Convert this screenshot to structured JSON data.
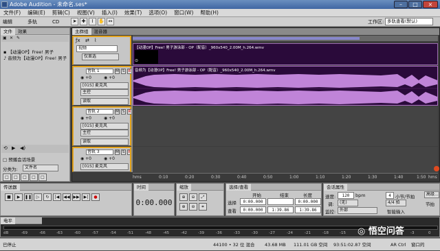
{
  "window": {
    "title": "Adobe Audition - 未命名.ses*",
    "min": "–",
    "max": "□",
    "close": "×"
  },
  "menu": [
    "文件(F)",
    "编辑(E)",
    "剪辑(C)",
    "视图(V)",
    "插入(I)",
    "效果(T)",
    "选项(O)",
    "窗口(W)",
    "帮助(H)"
  ],
  "toolbar": {
    "edit": "编辑",
    "multitrack": "多轨",
    "cd": "CD",
    "workspace_label": "工作区:",
    "workspace_value": "多轨查看(默认)"
  },
  "left_panel": {
    "tabs": [
      "文件",
      "效果"
    ],
    "files": [
      "【动漫OP】Free! 男子",
      "音频为【动漫OP】Free! 男子"
    ],
    "play_checkbox": "□ 预播会话场景",
    "sort_label": "分类为:",
    "sort_value": "文件名"
  },
  "main": {
    "tabs": [
      "主群组",
      "混音器"
    ],
    "video": {
      "name": "视频",
      "mode": "仅首选",
      "clip_title": "【动漫OP】Free! 男子游泳部 - OP（配音）_960x540_2.00M_h.264.wmv"
    },
    "tracks": [
      {
        "name": "音轨 1",
        "vol": "+0",
        "pan": "+0",
        "input": "[01S] 麦克风",
        "output": "主控",
        "read": "读取",
        "clip_title": "音频为【动漫OP】Free! 男子游泳部 - OP（配音）_960x540_2.00M_h.264.wmv"
      },
      {
        "name": "音轨 2",
        "vol": "+0",
        "pan": "+0",
        "input": "[01S] 麦克风",
        "output": "主控",
        "read": "读取"
      },
      {
        "name": "音轨 3",
        "vol": "+0",
        "pan": "+0",
        "input": "[01S] 麦克风",
        "output": "主控",
        "read": "读取"
      }
    ],
    "ruler": [
      "hms",
      "0:10",
      "0:20",
      "0:30",
      "0:40",
      "0:50",
      "1:00",
      "1:10",
      "1:20",
      "1:30",
      "1:40",
      "1:50",
      "hms"
    ]
  },
  "transport": {
    "title": "传送器"
  },
  "time": {
    "title": "时间",
    "display": "0:00.000"
  },
  "zoom": {
    "title": "缩放"
  },
  "selection": {
    "title": "选择/查看",
    "headers": [
      "开始",
      "结束",
      "长度"
    ],
    "select_label": "选择",
    "view_label": "查看",
    "select": [
      "0:00.000",
      "",
      "0:00.000"
    ],
    "view": [
      "0:00.000",
      "1:39.86",
      "1:39.86"
    ]
  },
  "session": {
    "title": "会话属性",
    "tempo_label": "速度:",
    "tempo": "120",
    "bpm": "bpm",
    "beats": "4",
    "beats_unit": "小节/节拍",
    "key_label": "调:",
    "key": "(无)",
    "time_sig": "4/4 拍",
    "mon_label": "监控:",
    "mon": "外部",
    "advanced": "高级...",
    "beat_label": "节拍",
    "adv2": "智能输入"
  },
  "level": {
    "title": "电平",
    "ticks": [
      "dB",
      "-69",
      "-66",
      "-63",
      "-60",
      "-57",
      "-54",
      "-51",
      "-48",
      "-45",
      "-42",
      "-39",
      "-36",
      "-33",
      "-30",
      "-27",
      "-24",
      "-21",
      "-18",
      "-15",
      "-12",
      "-9",
      "-6",
      "-3",
      "0"
    ]
  },
  "status": {
    "state": "已停止",
    "format": "44100 • 32 位 混合",
    "size": "43.68 MB",
    "free": "111.01 GB 空间",
    "disk_time": "93:51:02.87 空间",
    "ext": "AR Ctrl",
    "window": "窗口的"
  },
  "watermark": "悟空问答",
  "colors": {
    "clip_purple": "#2a0a3a",
    "wave": "#c084d8",
    "accent": "#e3a21a"
  }
}
